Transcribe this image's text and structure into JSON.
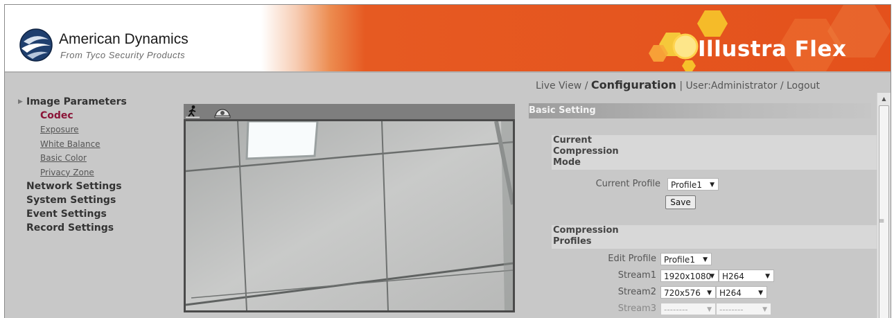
{
  "brand": {
    "name": "American Dynamics",
    "tagline": "From Tyco Security Products",
    "product": "Illustra Flex"
  },
  "topnav": {
    "live_view": "Live View",
    "sep1": " / ",
    "configuration": "Configuration",
    "sep2": " | ",
    "user": "User:Administrator",
    "sep3": " / ",
    "logout": "Logout"
  },
  "leftnav": {
    "image_parameters": "Image Parameters",
    "codec": "Codec",
    "exposure": "Exposure",
    "white_balance": "White Balance",
    "basic_color": "Basic Color",
    "privacy_zone": "Privacy Zone",
    "network_settings": "Network Settings",
    "system_settings": "System Settings",
    "event_settings": "Event Settings",
    "record_settings": "Record Settings"
  },
  "panel": {
    "basic_setting": "Basic Setting",
    "current_mode": {
      "line1": "Current",
      "line2": "Compression",
      "line3": "Mode"
    },
    "current_profile_label": "Current Profile",
    "current_profile_value": "Profile1",
    "save_label": "Save",
    "compression_profiles": {
      "line1": "Compression",
      "line2": "Profiles"
    },
    "edit_profile_label": "Edit Profile",
    "edit_profile_value": "Profile1",
    "streams": [
      {
        "label": "Stream1",
        "resolution": "1920x1080",
        "codec": "H264"
      },
      {
        "label": "Stream2",
        "resolution": "720x576",
        "codec": "H264"
      },
      {
        "label": "Stream3",
        "resolution": "--------",
        "codec": "--------"
      }
    ]
  },
  "icons": {
    "toolbar": [
      "walk-icon",
      "dome-camera-icon"
    ],
    "caret": "triangle-right-icon",
    "dropdown": "chevron-down-icon"
  },
  "colors": {
    "header_orange": "#e4511c",
    "active_menu": "#8b1538",
    "page_bg": "#c8c8c8"
  }
}
